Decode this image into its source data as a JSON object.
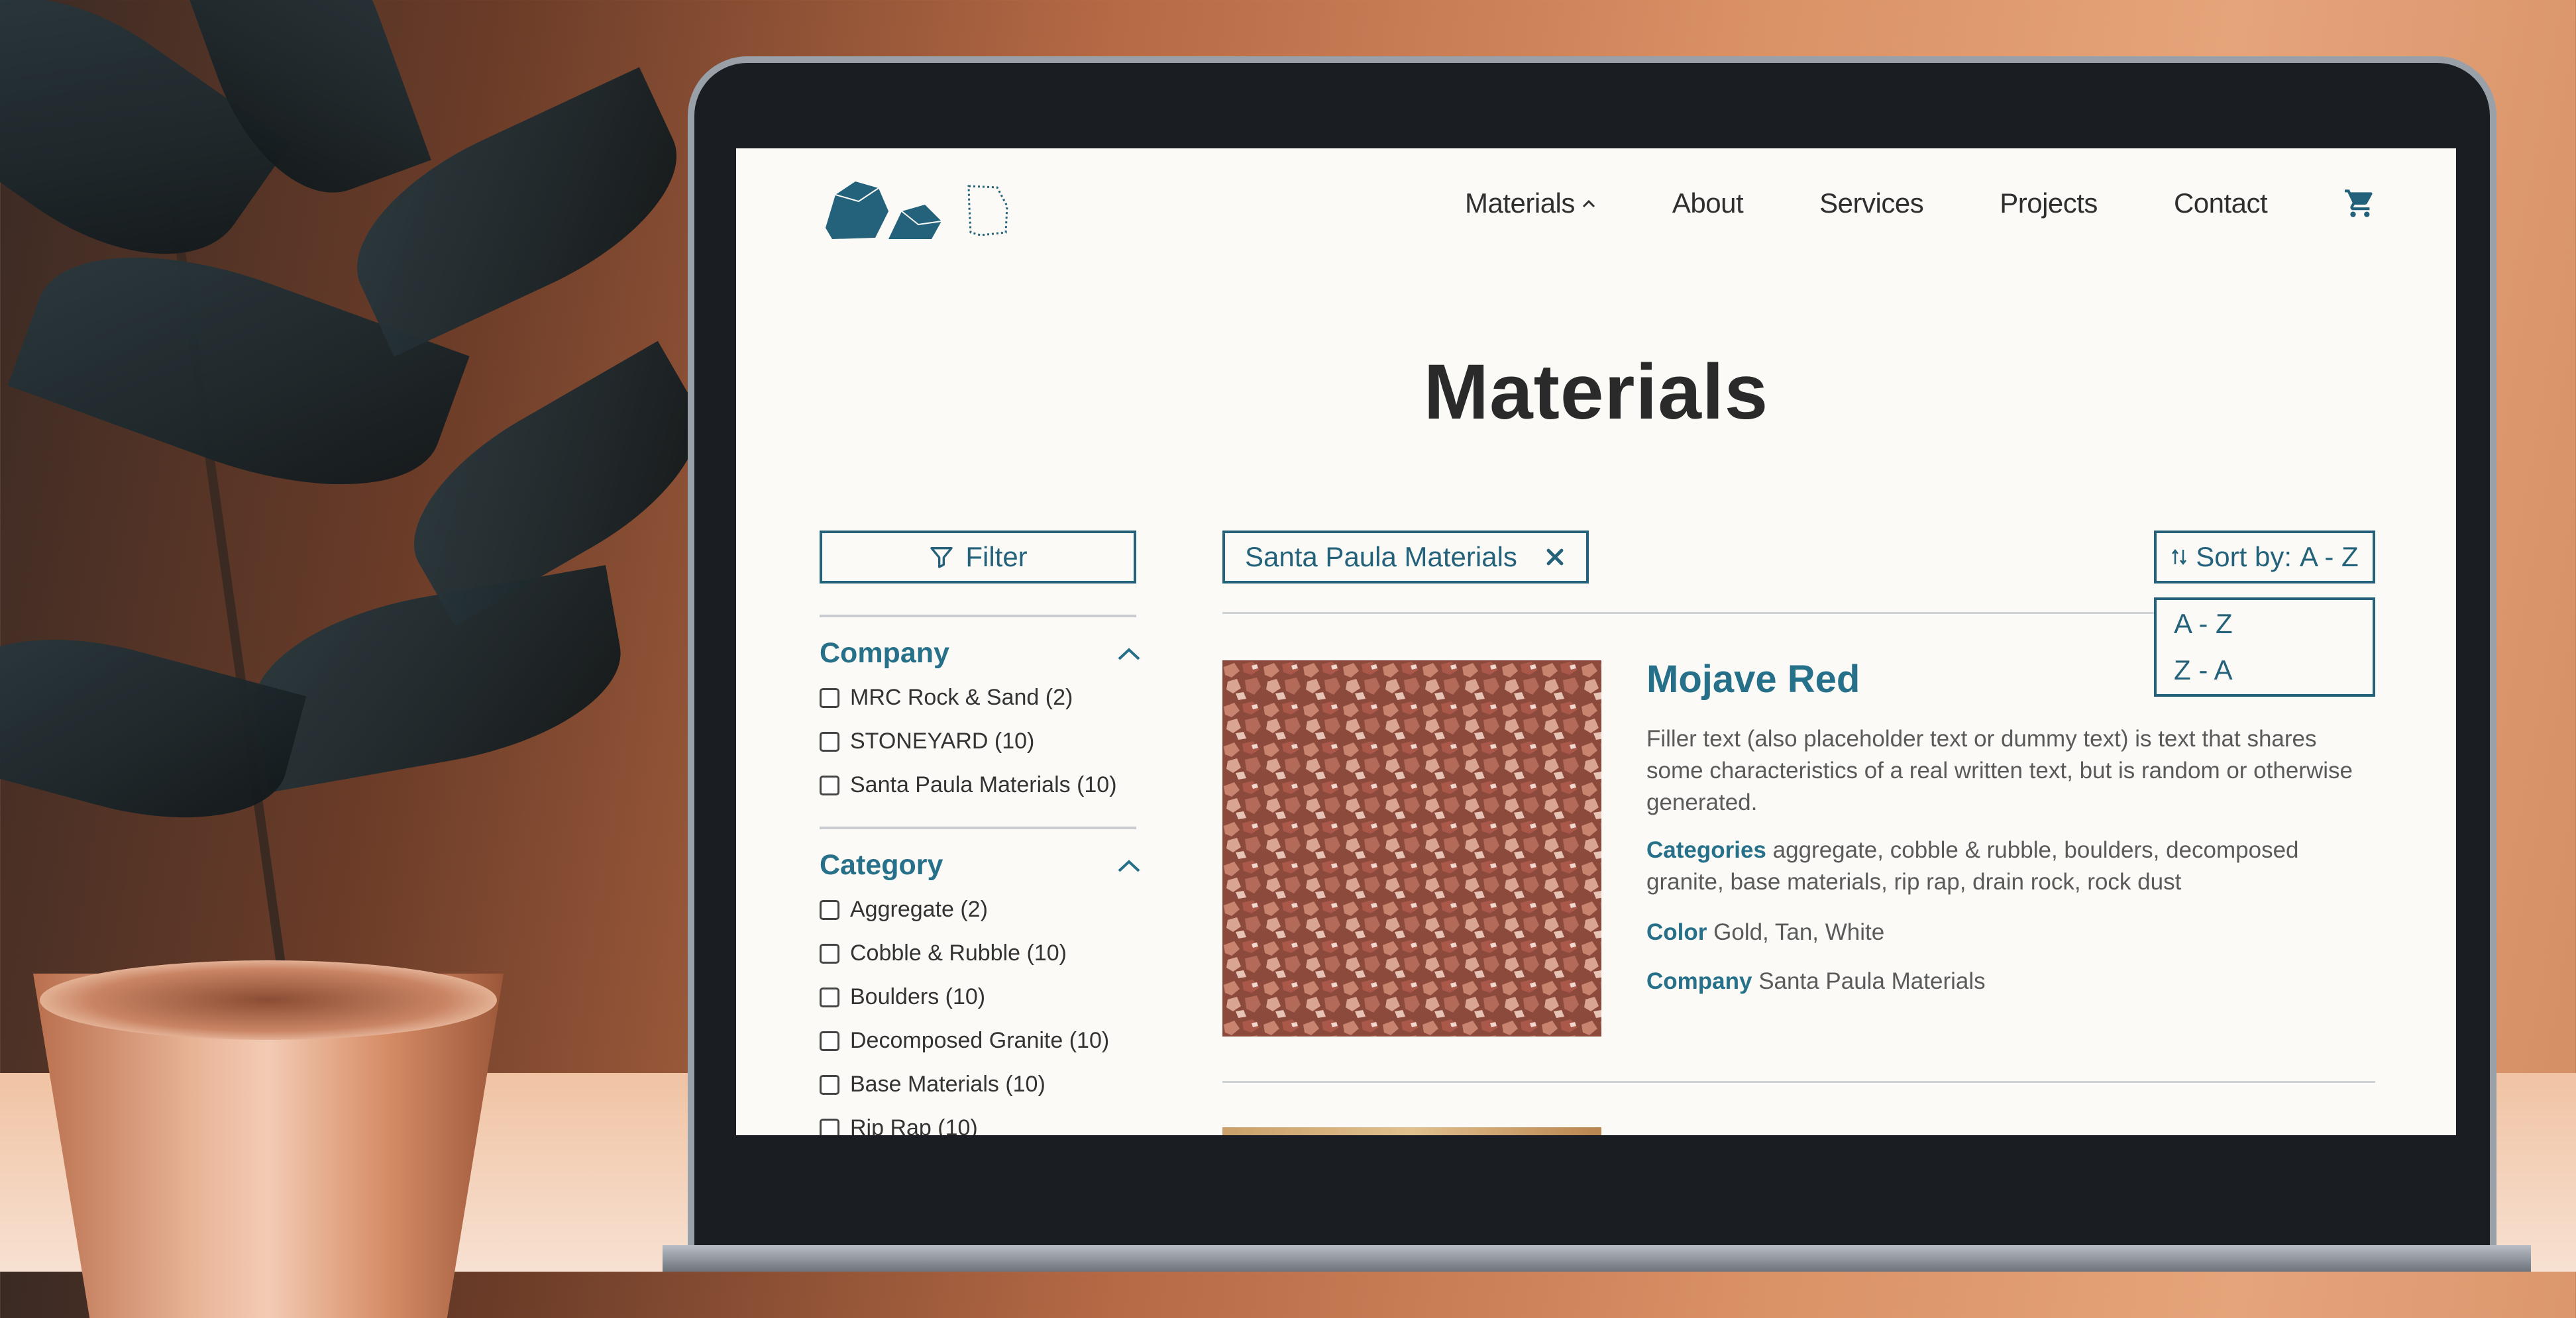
{
  "header": {
    "nav": [
      {
        "label": "Materials"
      },
      {
        "label": "About"
      },
      {
        "label": "Services"
      },
      {
        "label": "Projects"
      },
      {
        "label": "Contact"
      }
    ]
  },
  "page": {
    "title": "Materials"
  },
  "sidebar": {
    "filter_label": "Filter",
    "company": {
      "title": "Company",
      "options": [
        "MRC Rock & Sand (2)",
        "STONEYARD (10)",
        "Santa Paula Materials (10)"
      ]
    },
    "category": {
      "title": "Category",
      "options": [
        "Aggregate (2)",
        "Cobble & Rubble (10)",
        "Boulders (10)",
        "Decomposed Granite (10)",
        "Base Materials (10)",
        "Rip Rap (10)"
      ]
    }
  },
  "main": {
    "active_filter": "Santa Paula Materials",
    "sort": {
      "label": "Sort by:",
      "value": "A - Z",
      "options": [
        "A - Z",
        "Z - A"
      ]
    },
    "product": {
      "title": "Mojave Red",
      "description": "Filler text (also placeholder text or dummy text) is text that shares some characteristics of a real written text, but is random or otherwise generated.",
      "categories_label": "Categories",
      "categories_value": "aggregate, cobble & rubble, boulders, decomposed granite, base materials, rip rap, drain rock, rock dust",
      "color_label": "Color",
      "color_value": "Gold, Tan, White",
      "company_label": "Company",
      "company_value": "Santa Paula Materials"
    }
  },
  "colors": {
    "accent": "#23627a",
    "heading_accent": "#26708a",
    "background": "#fbfaf6"
  }
}
